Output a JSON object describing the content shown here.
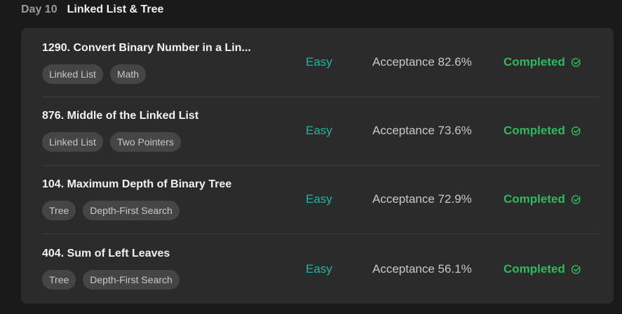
{
  "header": {
    "day": "Day 10",
    "title": "Linked List & Tree"
  },
  "colors": {
    "background": "#1a1a1a",
    "card": "#2b2b2b",
    "easy": "#1fb4a6",
    "completed": "#2cbb5d",
    "tag_bg": "#454545"
  },
  "problems": [
    {
      "title": "1290. Convert Binary Number in a Lin...",
      "tags": [
        "Linked List",
        "Math"
      ],
      "difficulty": "Easy",
      "acceptance": "Acceptance 82.6%",
      "status": "Completed",
      "status_icon": "check-circle-icon"
    },
    {
      "title": "876. Middle of the Linked List",
      "tags": [
        "Linked List",
        "Two Pointers"
      ],
      "difficulty": "Easy",
      "acceptance": "Acceptance 73.6%",
      "status": "Completed",
      "status_icon": "check-circle-icon"
    },
    {
      "title": "104. Maximum Depth of Binary Tree",
      "tags": [
        "Tree",
        "Depth-First Search"
      ],
      "difficulty": "Easy",
      "acceptance": "Acceptance 72.9%",
      "status": "Completed",
      "status_icon": "check-circle-icon"
    },
    {
      "title": "404. Sum of Left Leaves",
      "tags": [
        "Tree",
        "Depth-First Search"
      ],
      "difficulty": "Easy",
      "acceptance": "Acceptance 56.1%",
      "status": "Completed",
      "status_icon": "check-circle-icon"
    }
  ]
}
